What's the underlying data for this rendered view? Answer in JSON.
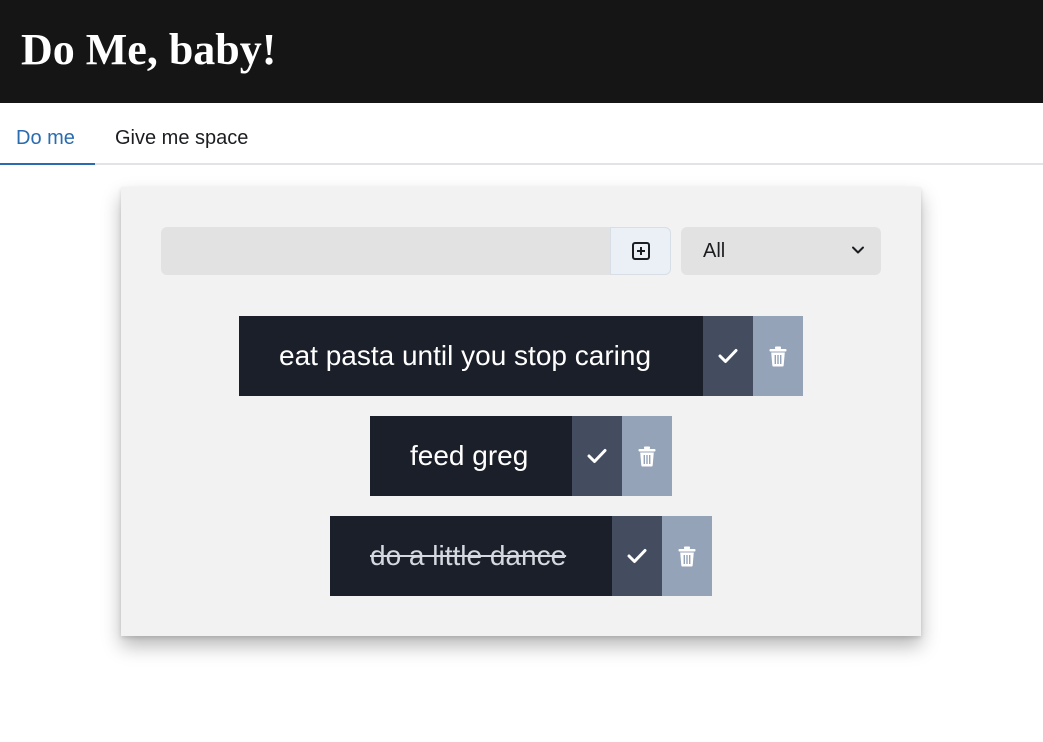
{
  "app": {
    "title": "Do Me, baby!"
  },
  "tabs": [
    {
      "label": "Do me",
      "active": true
    },
    {
      "label": "Give me space",
      "active": false
    }
  ],
  "new_todo": {
    "value": "",
    "add_icon": "plus-square-icon"
  },
  "filter": {
    "selected": "All",
    "icon": "chevron-down-icon"
  },
  "todos": [
    {
      "text": "eat pasta until you stop caring",
      "completed": false
    },
    {
      "text": "feed greg",
      "completed": false
    },
    {
      "text": "do a little dance",
      "completed": true
    }
  ],
  "colors": {
    "header_bg": "#151515",
    "active_tab": "#2b6cb0",
    "todo_bg": "#1b1f29",
    "check_bg": "#444d5f",
    "trash_bg": "#94a3b8"
  }
}
